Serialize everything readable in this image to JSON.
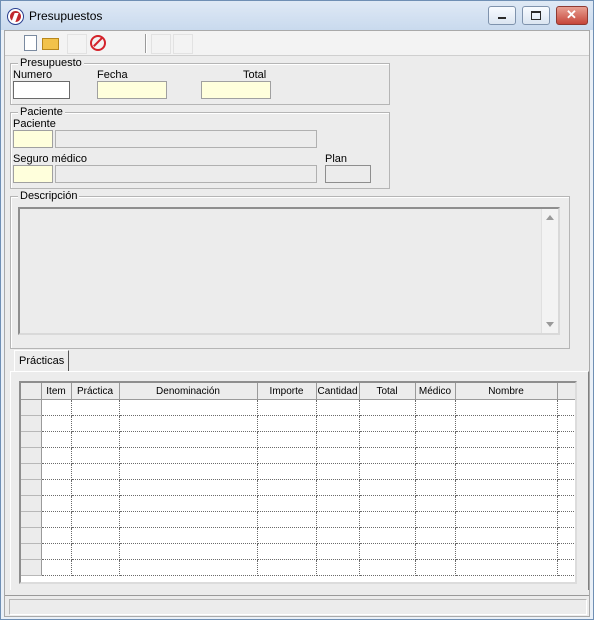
{
  "window": {
    "title": "Presupuestos",
    "min_glyph": "",
    "max_glyph": "",
    "close_glyph": "✕"
  },
  "toolbar": {
    "icons": [
      "new-document-icon",
      "open-folder-icon",
      "cancel-icon"
    ]
  },
  "presupuesto": {
    "legend": "Presupuesto",
    "numero_label": "Numero",
    "numero_value": "",
    "fecha_label": "Fecha",
    "fecha_value": "",
    "total_label": "Total",
    "total_value": ""
  },
  "paciente": {
    "legend": "Paciente",
    "paciente_label": "Paciente",
    "paciente_code": "",
    "paciente_name": "",
    "seguro_label": "Seguro médico",
    "seguro_code": "",
    "seguro_name": "",
    "plan_label": "Plan",
    "plan_value": ""
  },
  "descripcion": {
    "legend": "Descripción",
    "value": ""
  },
  "tabs": {
    "practicas": "Prácticas"
  },
  "grid": {
    "columns": [
      "Item",
      "Práctica",
      "Denominación",
      "Importe",
      "Cantidad",
      "Total",
      "Médico",
      "Nombre"
    ],
    "rows": 11
  }
}
